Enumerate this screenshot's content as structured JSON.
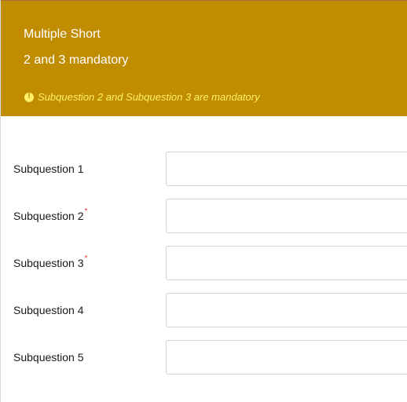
{
  "question": {
    "title": "Multiple Short",
    "subtitle": "2 and 3 mandatory",
    "warning_icon": "exclamation-circle-icon",
    "warning_text": "Subquestion 2 and Subquestion 3 are mandatory"
  },
  "colors": {
    "header_background": "#c08c00",
    "header_text": "#ffffff",
    "warning_text": "#fff26a",
    "required_marker": "#e23030",
    "input_border": "#ccd5df"
  },
  "subquestions": [
    {
      "label": "Subquestion 1",
      "required": false,
      "required_marker": "",
      "value": ""
    },
    {
      "label": "Subquestion 2",
      "required": true,
      "required_marker": "*",
      "value": ""
    },
    {
      "label": "Subquestion 3",
      "required": true,
      "required_marker": "*",
      "value": ""
    },
    {
      "label": "Subquestion 4",
      "required": false,
      "required_marker": "",
      "value": ""
    },
    {
      "label": "Subquestion 5",
      "required": false,
      "required_marker": "",
      "value": ""
    }
  ]
}
